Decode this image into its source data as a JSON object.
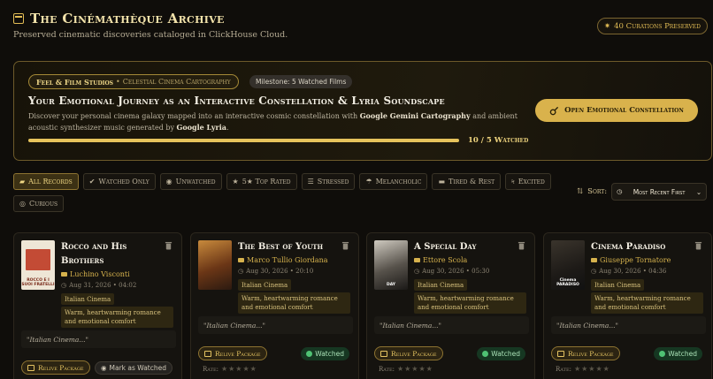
{
  "header": {
    "title": "The Cinémathèque Archive",
    "subtitle": "Preserved cinematic discoveries cataloged in ClickHouse Cloud.",
    "curations_badge": "40 Curations Preserved"
  },
  "hero": {
    "studio_name": "Feel & Film Studios",
    "studio_sep": "•",
    "studio_product": "Celestial Cinema Cartography",
    "milestone": "Milestone: 5 Watched Films",
    "title": "Your Emotional Journey as an Interactive Constellation & Lyria Soundscape",
    "desc_1": "Discover your personal cinema galaxy mapped into an interactive cosmic constellation with ",
    "desc_b1": "Google Gemini Cartography",
    "desc_2": " and ambient acoustic synthesizer music generated by ",
    "desc_b2": "Google Lyria",
    "desc_3": ".",
    "progress_label": "10 / 5 Watched",
    "progress_fraction": 1.0,
    "open_button": "Open Emotional Constellation"
  },
  "filters": [
    {
      "label": "All Records",
      "icon": "folder-icon",
      "glyph": "▰",
      "active": true
    },
    {
      "label": "Watched Only",
      "icon": "check-circle-icon",
      "glyph": "✔",
      "active": false
    },
    {
      "label": "Unwatched",
      "icon": "eye-icon",
      "glyph": "◉",
      "active": false
    },
    {
      "label": "5★ Top Rated",
      "icon": "star-icon",
      "glyph": "★",
      "active": false
    },
    {
      "label": "Stressed",
      "icon": "stressed-icon",
      "glyph": "☰",
      "active": false
    },
    {
      "label": "Melancholic",
      "icon": "cloud-rain-icon",
      "glyph": "☂",
      "active": false
    },
    {
      "label": "Tired & Rest",
      "icon": "bed-icon",
      "glyph": "▬",
      "active": false
    },
    {
      "label": "Excited",
      "icon": "bolt-icon",
      "glyph": "ϟ",
      "active": false
    },
    {
      "label": "Curious",
      "icon": "compass-icon",
      "glyph": "◎",
      "active": false
    }
  ],
  "sort": {
    "label": "Sort:",
    "selected": "Most Recent First"
  },
  "cards": [
    {
      "title": "Rocco and His Brothers",
      "director": "Luchino Visconti",
      "date": "Aug 31, 2026 • 04:02",
      "tag": "Italian Cinema",
      "mood": "Warm, heartwarming romance and emotional comfort",
      "quote": "\"Italian Cinema...\"",
      "relive": "Relive Package",
      "status": "Mark as Watched",
      "watched": false,
      "rate_label": "",
      "rating": 0,
      "poster_text": "ROCCO E I SUOI FRATELLI"
    },
    {
      "title": "The Best of Youth",
      "director": "Marco Tullio Giordana",
      "date": "Aug 30, 2026 • 20:10",
      "tag": "Italian Cinema",
      "mood": "Warm, heartwarming romance and emotional comfort",
      "quote": "\"Italian Cinema...\"",
      "relive": "Relive Package",
      "status": "Watched",
      "watched": true,
      "rate_label": "Rate:",
      "rating": 0,
      "poster_text": ""
    },
    {
      "title": "A Special Day",
      "director": "Ettore Scola",
      "date": "Aug 30, 2026 • 05:30",
      "tag": "Italian Cinema",
      "mood": "Warm, heartwarming romance and emotional comfort",
      "quote": "\"Italian Cinema...\"",
      "relive": "Relive Package",
      "status": "Watched",
      "watched": true,
      "rate_label": "Rate:",
      "rating": 0,
      "poster_text": "DAY"
    },
    {
      "title": "Cinema Paradiso",
      "director": "Giuseppe Tornatore",
      "date": "Aug 30, 2026 • 04:36",
      "tag": "Italian Cinema",
      "mood": "Warm, heartwarming romance and emotional comfort",
      "quote": "\"Italian Cinema...\"",
      "relive": "Relive Package",
      "status": "Watched",
      "watched": true,
      "rate_label": "Rate:",
      "rating": 0,
      "poster_text": "Cinema PARADISO"
    }
  ],
  "colors": {
    "accent": "#e2bc55",
    "background": "#0f0d0a",
    "watched": "#163722"
  }
}
